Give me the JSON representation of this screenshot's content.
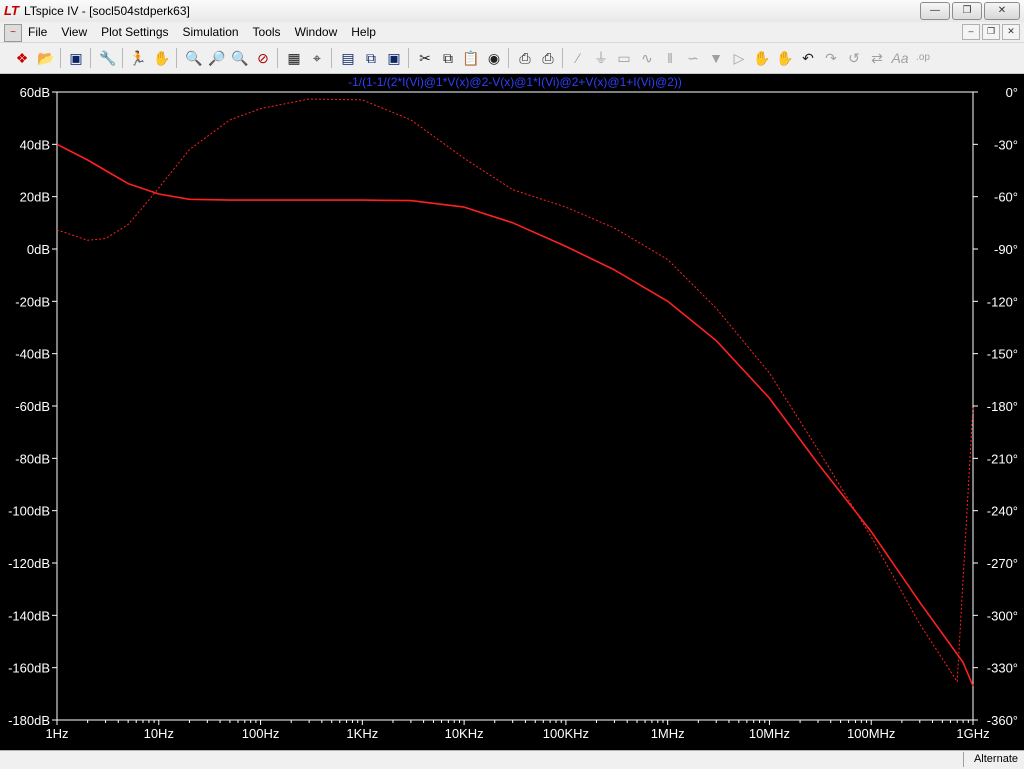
{
  "window": {
    "title": "LTspice IV - [socl504stdperk63]",
    "logo": "LT"
  },
  "menu": [
    "File",
    "View",
    "Plot Settings",
    "Simulation",
    "Tools",
    "Window",
    "Help"
  ],
  "toolbar": {
    "icons": [
      "new-schematic-icon",
      "open-icon",
      "save-icon",
      "control-panel-icon",
      "run-icon",
      "halt-icon",
      "zoom-in-icon",
      "zoom-area-icon",
      "zoom-out-icon",
      "zoom-cancel-icon",
      "autorange-icon",
      "cursor-icon",
      "tile-horizontal-icon",
      "cascade-icon",
      "close-all-icon",
      "cut-icon",
      "copy-icon",
      "paste-icon",
      "find-icon",
      "print-preview-icon",
      "print-icon",
      "wire-icon",
      "ground-icon",
      "label-icon",
      "resistor-icon",
      "capacitor-icon",
      "inductor-icon",
      "diode-icon",
      "component-icon",
      "move-icon",
      "drag-icon",
      "undo-icon",
      "redo-icon",
      "rotate-icon",
      "mirror-icon",
      "text-icon",
      "spice-directive-icon"
    ]
  },
  "colors": {
    "plot_bg": "#000000",
    "trace": "#ff2020",
    "axis_text": "#ffffff",
    "expression_text": "#2f3fff"
  },
  "chart_data": {
    "type": "line",
    "title": "-1/(1-1/(2*I(Vi)@1*V(x)@2-V(x)@1*I(Vi)@2+V(x)@1+I(Vi)@2))",
    "xscale": "log",
    "xlim": [
      1,
      1000000000
    ],
    "x_tick_labels": [
      "1Hz",
      "10Hz",
      "100Hz",
      "1KHz",
      "10KHz",
      "100KHz",
      "1MHz",
      "10MHz",
      "100MHz",
      "1GHz"
    ],
    "ylim": [
      -180,
      60
    ],
    "y_tick_labels": [
      "60dB",
      "40dB",
      "20dB",
      "0dB",
      "-20dB",
      "-40dB",
      "-60dB",
      "-80dB",
      "-100dB",
      "-120dB",
      "-140dB",
      "-160dB",
      "-180dB"
    ],
    "y2lim": [
      -360,
      0
    ],
    "y2_tick_labels": [
      "0°",
      "-30°",
      "-60°",
      "-90°",
      "-120°",
      "-150°",
      "-180°",
      "-210°",
      "-240°",
      "-270°",
      "-300°",
      "-330°",
      "-360°"
    ],
    "grid": false,
    "series": [
      {
        "style": "solid",
        "axis": "left",
        "x": [
          1,
          2,
          3,
          5,
          10,
          20,
          50,
          100,
          300,
          1000,
          3000,
          10000,
          30000,
          100000,
          300000,
          1000000,
          3000000,
          10000000,
          30000000,
          100000000,
          300000000,
          800000000,
          1000000000
        ],
        "values": [
          40,
          34,
          30,
          25,
          21,
          19,
          18.7,
          18.7,
          18.7,
          18.7,
          18.5,
          16,
          10,
          1,
          -8,
          -20,
          -35,
          -57,
          -82,
          -108,
          -135,
          -158,
          -167
        ]
      },
      {
        "style": "dotted",
        "axis": "right",
        "x": [
          1,
          2,
          3,
          5,
          7,
          10,
          20,
          50,
          100,
          300,
          1000,
          3000,
          10000,
          30000,
          100000,
          300000,
          1000000,
          3000000,
          10000000,
          30000000,
          100000000,
          300000000,
          700000000,
          1000000000
        ],
        "values": [
          -79,
          -85,
          -84,
          -76,
          -66,
          -55,
          -33,
          -16,
          -9.5,
          -4,
          -4.5,
          -16,
          -38,
          -56,
          -66,
          -78,
          -96,
          -124,
          -161,
          -205,
          -255,
          -305,
          -338,
          -180
        ]
      }
    ]
  },
  "status": {
    "mode": "Alternate"
  }
}
